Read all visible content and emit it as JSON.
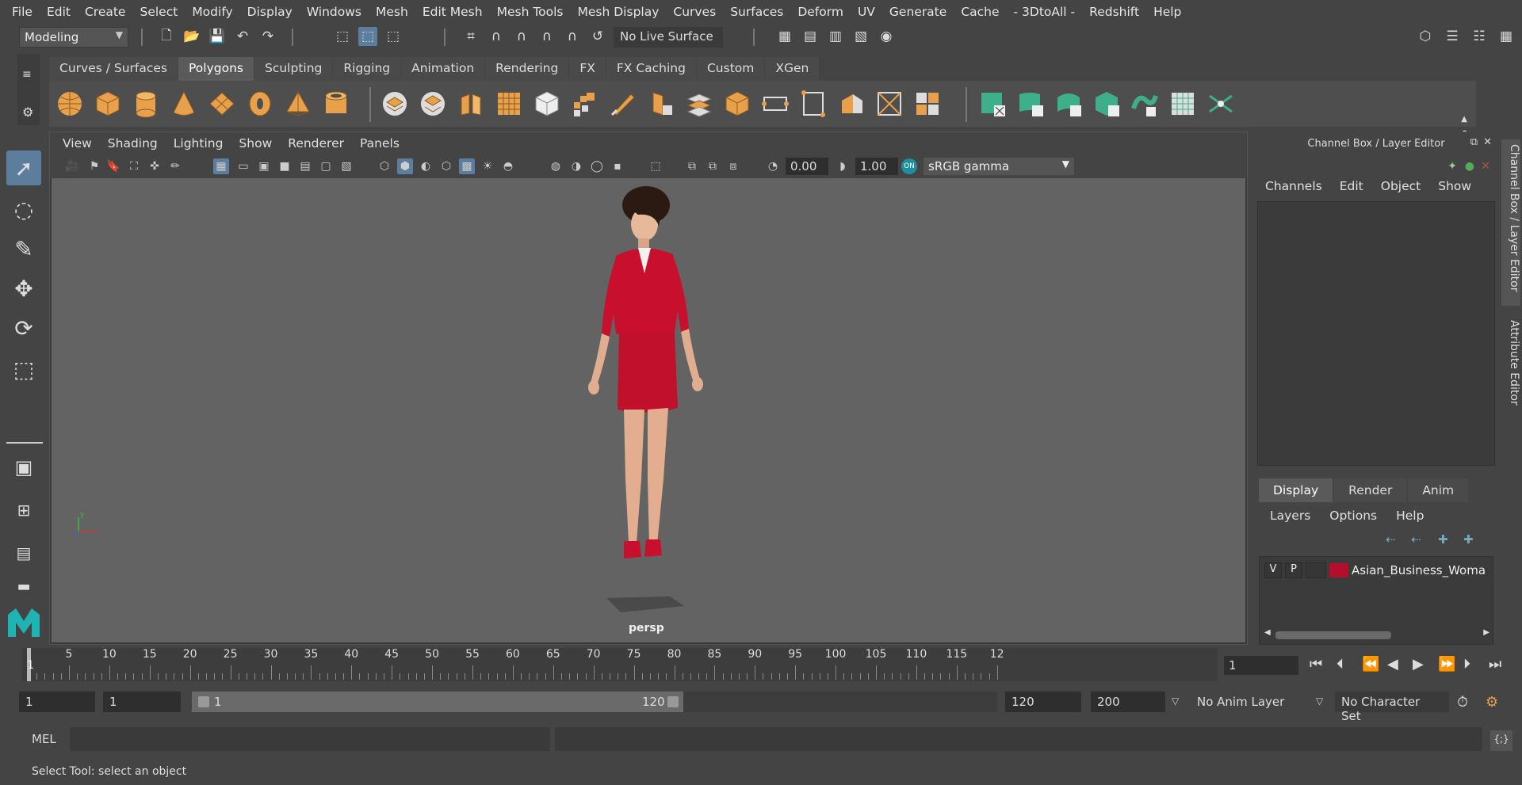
{
  "menubar": [
    "File",
    "Edit",
    "Create",
    "Select",
    "Modify",
    "Display",
    "Windows",
    "Mesh",
    "Edit Mesh",
    "Mesh Tools",
    "Mesh Display",
    "Curves",
    "Surfaces",
    "Deform",
    "UV",
    "Generate",
    "Cache",
    "- 3DtoAll -",
    "Redshift",
    "Help"
  ],
  "status_line": {
    "menu_set": "Modeling",
    "live_surface": "No Live Surface"
  },
  "shelf": {
    "tabs": [
      "Curves / Surfaces",
      "Polygons",
      "Sculpting",
      "Rigging",
      "Animation",
      "Rendering",
      "FX",
      "FX Caching",
      "Custom",
      "XGen"
    ],
    "active_tab": "Polygons"
  },
  "viewport": {
    "menu": [
      "View",
      "Shading",
      "Lighting",
      "Show",
      "Renderer",
      "Panels"
    ],
    "exposure": "0.00",
    "gamma": "1.00",
    "color_space": "sRGB gamma",
    "camera_label": "persp",
    "axis_x": "x",
    "axis_y": "y"
  },
  "channel_box": {
    "title": "Channel Box / Layer Editor",
    "menu": [
      "Channels",
      "Edit",
      "Object",
      "Show"
    ]
  },
  "layer_editor": {
    "tabs": [
      "Display",
      "Render",
      "Anim"
    ],
    "active_tab": "Display",
    "menu": [
      "Layers",
      "Options",
      "Help"
    ],
    "layers": [
      {
        "visible": "V",
        "playback": "P",
        "color": "#b40e2c",
        "name": "Asian_Business_Woma"
      }
    ]
  },
  "side_tabs": [
    "Channel Box / Layer Editor",
    "Attribute Editor"
  ],
  "timeline": {
    "ticks": [
      "5",
      "10",
      "15",
      "20",
      "25",
      "30",
      "35",
      "40",
      "45",
      "50",
      "55",
      "60",
      "65",
      "70",
      "75",
      "80",
      "85",
      "90",
      "95",
      "100",
      "105",
      "110",
      "115",
      "12"
    ],
    "current_marker": "1",
    "current_frame": "1"
  },
  "range": {
    "start": "1",
    "playback_start": "1",
    "slider_start": "1",
    "slider_end": "120",
    "playback_end": "120",
    "end": "200",
    "anim_layer": "No Anim Layer",
    "character_set": "No Character Set"
  },
  "command_line": {
    "label": "MEL"
  },
  "help_line": "Select Tool: select an object",
  "colors": {
    "accent": "#5d7d9c",
    "shelf_orange": "#e8a04a",
    "shelf_teal": "#3fae8a",
    "suit_red": "#c8102e"
  }
}
